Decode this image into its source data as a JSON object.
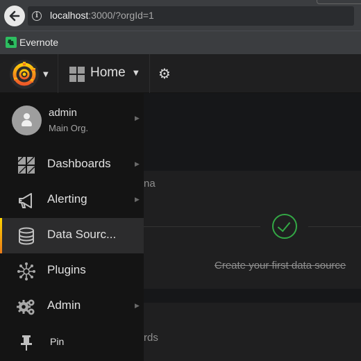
{
  "browser": {
    "url_host": "localhost",
    "url_rest": ":3000/?orgId=1",
    "bookmark_label": "Evernote"
  },
  "navbar": {
    "home_label": "Home"
  },
  "sidemenu": {
    "user": {
      "name": "admin",
      "org": "Main Org."
    },
    "items": [
      {
        "label": "Dashboards",
        "icon": "dashboards-icon"
      },
      {
        "label": "Alerting",
        "icon": "alerting-icon"
      },
      {
        "label": "Data Sourc...",
        "icon": "database-icon",
        "active": true
      },
      {
        "label": "Plugins",
        "icon": "plugins-icon"
      },
      {
        "label": "Admin",
        "icon": "admin-gears-icon"
      },
      {
        "label": "Pin",
        "icon": "pin-icon"
      }
    ]
  },
  "main": {
    "partial_text_1": "na",
    "partial_text_2": "rds",
    "create_datasource": "Create your first data source"
  },
  "colors": {
    "active_accent_top": "#ffd500",
    "active_accent_bottom": "#eb7b18",
    "check_green": "#33a845",
    "evernote_green": "#2dbe60"
  }
}
